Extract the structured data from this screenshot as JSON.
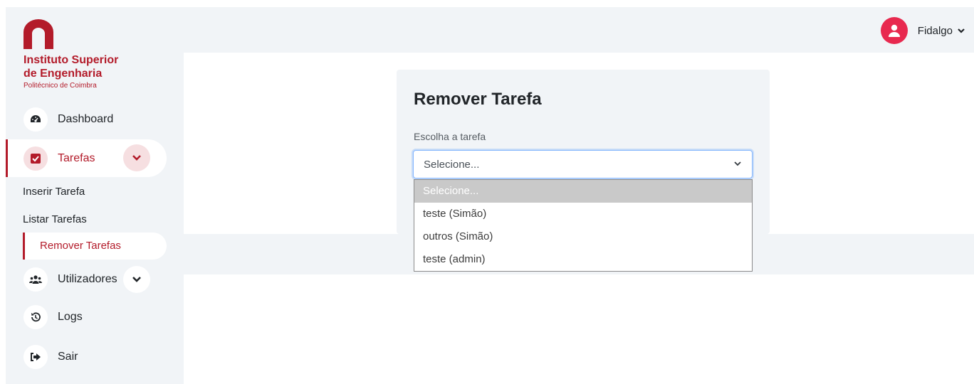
{
  "brand": {
    "title_line1": "Instituto Superior",
    "title_line2": "de Engenharia",
    "subtitle": "Politécnico de Coimbra",
    "color": "#b31b2a"
  },
  "header": {
    "user_name": "Fidalgo",
    "avatar_icon": "user-icon",
    "avatar_color": "#e8294f"
  },
  "sidebar": {
    "items": [
      {
        "label": "Dashboard",
        "icon": "dashboard-gauge-icon"
      },
      {
        "label": "Tarefas",
        "icon": "checkbox-icon",
        "active": true
      },
      {
        "label": "Utilizadores",
        "icon": "users-icon"
      },
      {
        "label": "Logs",
        "icon": "history-icon"
      },
      {
        "label": "Sair",
        "icon": "sign-out-icon"
      }
    ],
    "tarefas_sub": [
      {
        "label": "Inserir Tarefa"
      },
      {
        "label": "Listar Tarefas"
      },
      {
        "label": "Remover Tarefas",
        "active": true
      }
    ]
  },
  "main": {
    "title": "Remover Tarefa",
    "field_label": "Escolha a tarefa",
    "select": {
      "value": "Selecione...",
      "options": [
        "Selecione...",
        "teste (Simão)",
        "outros (Simão)",
        "teste (admin)"
      ],
      "highlighted_index": 0
    }
  }
}
